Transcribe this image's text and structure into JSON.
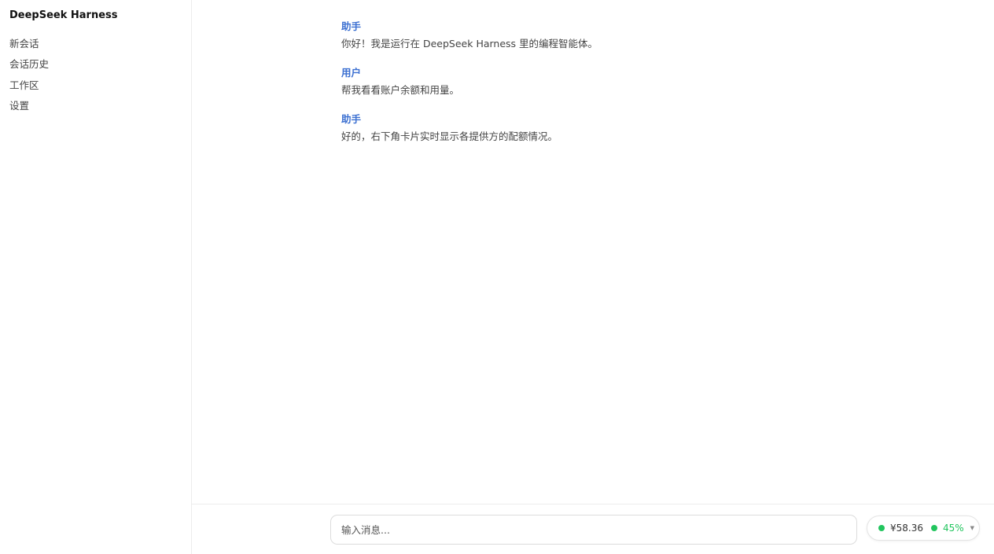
{
  "app": {
    "title": "DeepSeek Harness"
  },
  "sidebar": {
    "items": [
      {
        "label": "新会话"
      },
      {
        "label": "会话历史"
      },
      {
        "label": "工作区"
      },
      {
        "label": "设置"
      }
    ]
  },
  "messages": [
    {
      "role": "助手",
      "text": "你好！我是运行在 DeepSeek Harness 里的编程智能体。"
    },
    {
      "role": "用户",
      "text": "帮我看看账户余额和用量。"
    },
    {
      "role": "助手",
      "text": "好的，右下角卡片实时显示各提供方的配额情况。"
    }
  ],
  "composer": {
    "placeholder": "输入消息...",
    "value": ""
  },
  "quota_card": {
    "balance": "¥58.36",
    "usage": "45%",
    "usage_fraction": 0.45,
    "status_color": "#22c55e",
    "caret_icon": "caret-down-icon"
  },
  "colors": {
    "role_label": "#3b6fd1",
    "status_ok": "#22c55e"
  }
}
